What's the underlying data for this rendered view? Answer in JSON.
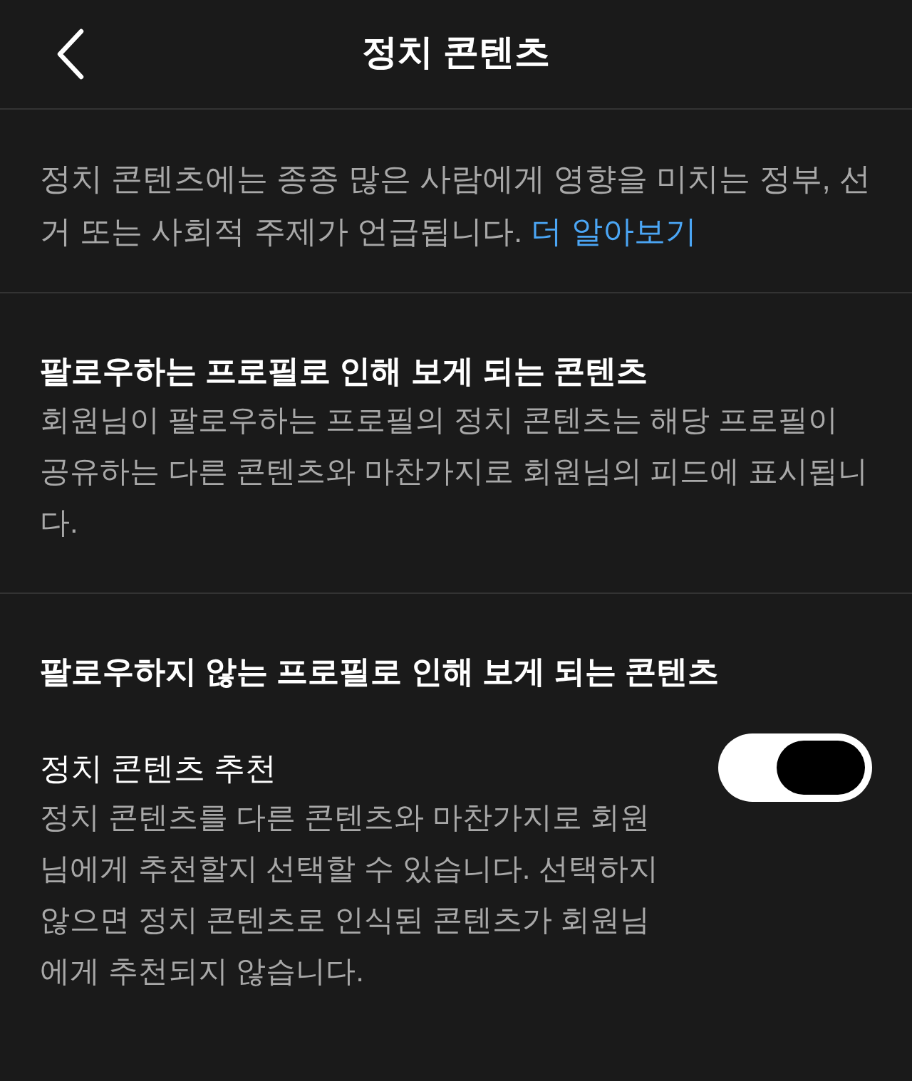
{
  "header": {
    "title": "정치 콘텐츠"
  },
  "intro": {
    "text": "정치 콘텐츠에는 종종 많은 사람에게 영향을 미치는 정부, 선거 또는 사회적 주제가 언급됩니다.",
    "link": "더 알아보기"
  },
  "sections": [
    {
      "heading": "팔로우하는 프로필로 인해 보게 되는 콘텐츠",
      "description": "회원님이 팔로우하는 프로필의 정치 콘텐츠는 해당 프로필이 공유하는 다른 콘텐츠와 마찬가지로 회원님의 피드에 표시됩니다."
    },
    {
      "heading": "팔로우하지 않는 프로필로 인해 보게 되는 콘텐츠",
      "settings": [
        {
          "label": "정치 콘텐츠 추천",
          "on": true,
          "description": "정치 콘텐츠를 다른 콘텐츠와 마찬가지로 회원님에게 추천할지 선택할 수 있습니다. 선택하지 않으면 정치 콘텐츠로 인식된 콘텐츠가 회원님에게 추천되지 않습니다."
        }
      ]
    }
  ]
}
